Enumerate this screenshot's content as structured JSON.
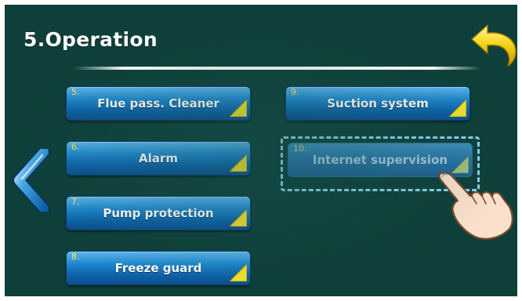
{
  "screen": {
    "title": "5.Operation",
    "colors": {
      "background": "#0e3f3a",
      "button": "#1e86cc",
      "number": "#ffe84a",
      "accent_corner": "#f5e22a",
      "dashed_frame": "#8fd0ee"
    },
    "icons": {
      "back": "yellow-return-arrow-icon",
      "prev": "blue-chevron-left-icon",
      "corner": "yellow-corner-triangle-icon",
      "pointer": "pointing-hand-icon"
    }
  },
  "menu": {
    "left": [
      {
        "number": "5.",
        "label": "Flue pass. Cleaner"
      },
      {
        "number": "6.",
        "label": "Alarm"
      },
      {
        "number": "7.",
        "label": "Pump protection"
      },
      {
        "number": "8.",
        "label": "Freeze guard"
      }
    ],
    "right": [
      {
        "number": "9.",
        "label": "Suction system"
      },
      {
        "number": "10.",
        "label": "Internet supervision"
      }
    ]
  }
}
